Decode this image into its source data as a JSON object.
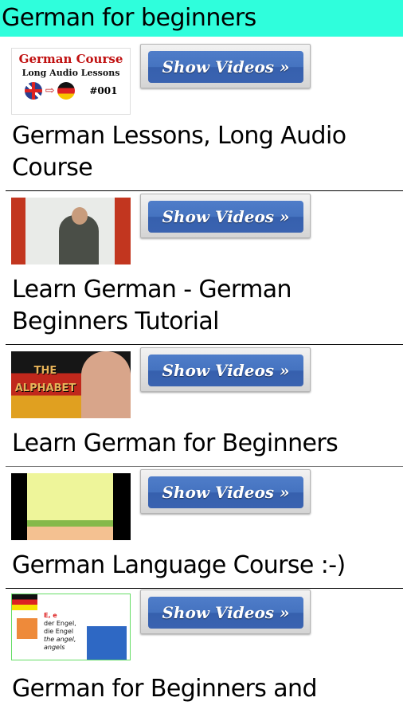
{
  "app": {
    "title": "German for beginners",
    "header_color": "#2ffedc"
  },
  "button_label": "Show Videos  »",
  "entries": [
    {
      "thumbnail": {
        "name": "german-course-thumbnail",
        "line1": "German Course",
        "line2": "Long Audio Lessons",
        "code": "#001",
        "arrow": "⇨"
      },
      "button": "Show Videos  »",
      "title": "German Lessons, Long Audio Course"
    },
    {
      "thumbnail": {
        "name": "whiteboard-teacher-thumbnail"
      },
      "button": "Show Videos  »",
      "title": "Learn German - German Beginners Tutorial"
    },
    {
      "thumbnail": {
        "name": "alphabet-thumbnail",
        "text_line1": "THE",
        "text_line2": "ALPHABET"
      },
      "button": "Show Videos  »",
      "title": "Learn German for Beginners"
    },
    {
      "thumbnail": {
        "name": "alphabet-table-thumbnail"
      },
      "button": "Show Videos  »",
      "title": "German Language Course :-)"
    },
    {
      "thumbnail": {
        "name": "letter-e-angel-thumbnail",
        "l1": "E, e",
        "l2": "der Engel,",
        "l3": "die Engel",
        "l4": "the angel,",
        "l5": "angels"
      },
      "button": "Show Videos  »",
      "title": "German for Beginners and"
    }
  ]
}
